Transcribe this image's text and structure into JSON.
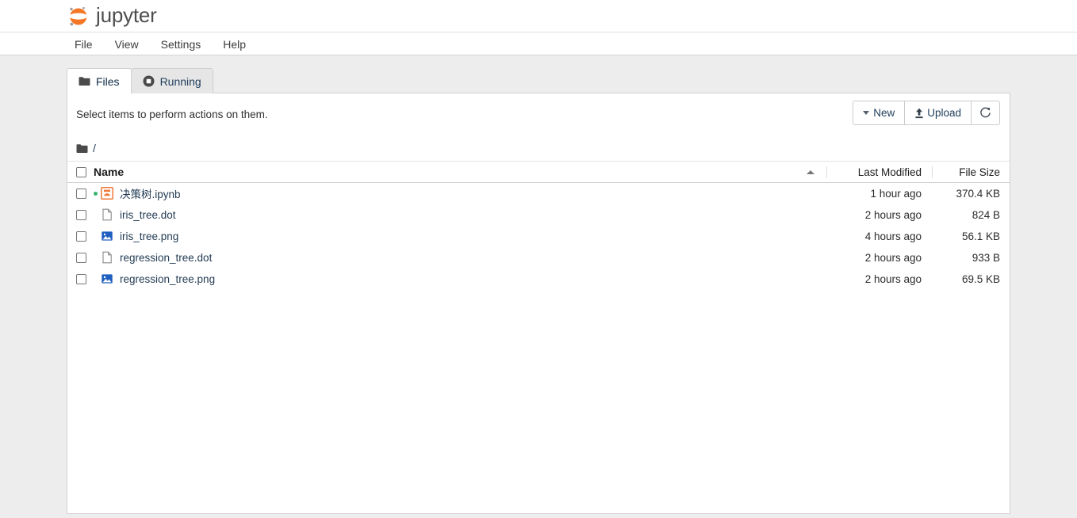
{
  "brand": {
    "name": "jupyter",
    "logo_icon": "jupyter-logo-icon",
    "logo_color": "#f37726"
  },
  "menu": {
    "items": [
      {
        "label": "File",
        "name": "menu-item-file"
      },
      {
        "label": "View",
        "name": "menu-item-view"
      },
      {
        "label": "Settings",
        "name": "menu-item-settings"
      },
      {
        "label": "Help",
        "name": "menu-item-help"
      }
    ]
  },
  "tabs": [
    {
      "label": "Files",
      "icon": "folder-icon",
      "active": true
    },
    {
      "label": "Running",
      "icon": "stop-circle-icon",
      "active": false
    }
  ],
  "panel": {
    "select_hint": "Select items to perform actions on them.",
    "toolbar": {
      "new_label": "New",
      "new_icon": "chevron-down-icon",
      "upload_label": "Upload",
      "upload_icon": "upload-icon",
      "refresh_icon": "refresh-icon"
    },
    "breadcrumb": {
      "root_icon": "folder-icon",
      "path": "/"
    },
    "table": {
      "columns": {
        "name": "Name",
        "last_modified": "Last Modified",
        "file_size": "File Size"
      },
      "sort": {
        "column": "Name",
        "direction": "ascending",
        "icon": "sort-asc-icon"
      },
      "rows": [
        {
          "name": "决策树.ipynb",
          "icon": "notebook-icon",
          "running": true,
          "last_modified": "1 hour ago",
          "file_size": "370.4 KB",
          "checked": false
        },
        {
          "name": "iris_tree.dot",
          "icon": "file-icon",
          "running": false,
          "last_modified": "2 hours ago",
          "file_size": "824 B",
          "checked": false
        },
        {
          "name": "iris_tree.png",
          "icon": "image-icon",
          "running": false,
          "last_modified": "4 hours ago",
          "file_size": "56.1 KB",
          "checked": false
        },
        {
          "name": "regression_tree.dot",
          "icon": "file-icon",
          "running": false,
          "last_modified": "2 hours ago",
          "file_size": "933 B",
          "checked": false
        },
        {
          "name": "regression_tree.png",
          "icon": "image-icon",
          "running": false,
          "last_modified": "2 hours ago",
          "file_size": "69.5 KB",
          "checked": false
        }
      ]
    }
  },
  "colors": {
    "brand_orange": "#f37726",
    "link": "#233c54",
    "running_dot": "#3cb371",
    "image_icon": "#1f5fbf",
    "page_bg": "#ededed"
  }
}
